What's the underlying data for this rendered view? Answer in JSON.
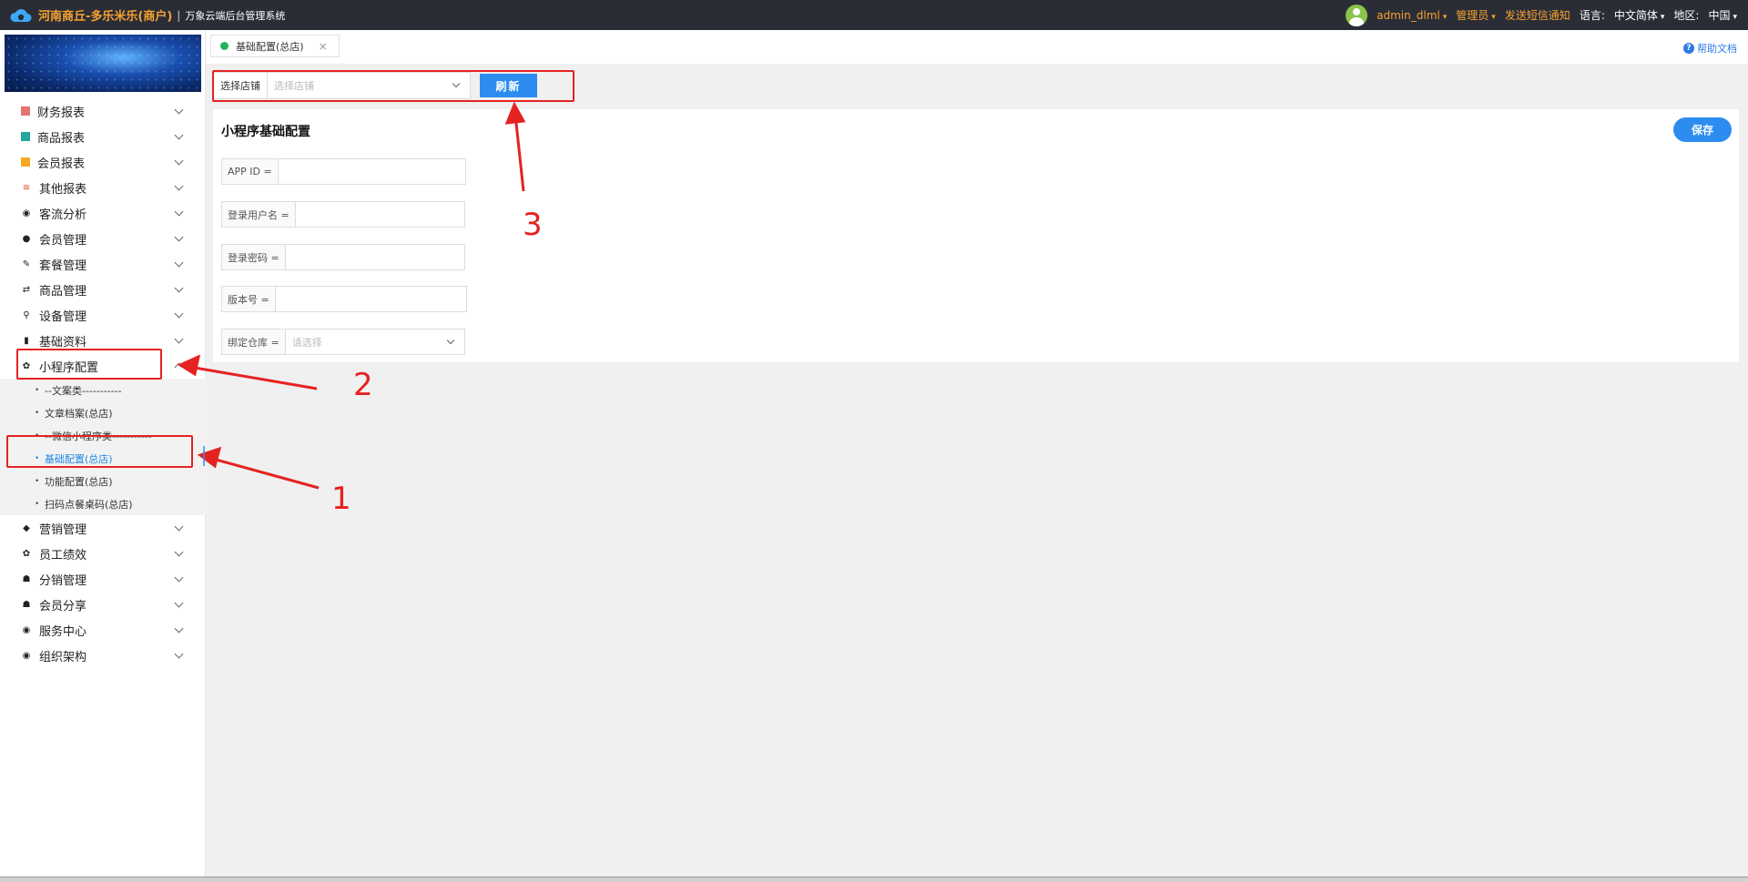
{
  "header": {
    "brand_title": "河南商丘-多乐米乐(商户)",
    "separator": "|",
    "brand_subtitle": "万象云端后台管理系统",
    "username": "admin_dlml",
    "role": "管理员",
    "sms_notice": "发送短信通知",
    "language_label": "语言:",
    "language_value": "中文简体",
    "region_label": "地区:",
    "region_value": "中国"
  },
  "sidebar": {
    "items": [
      {
        "label": "财务报表",
        "icon": "finance-report-icon",
        "color": "#e57373"
      },
      {
        "label": "商品报表",
        "icon": "goods-report-icon",
        "color": "#26a69a"
      },
      {
        "label": "会员报表",
        "icon": "member-report-icon",
        "color": "#f9a825"
      },
      {
        "label": "其他报表",
        "icon": "other-report-icon",
        "color": "#e64a19"
      },
      {
        "label": "客流分析",
        "icon": "traffic-analysis-icon",
        "color": "#555"
      },
      {
        "label": "会员管理",
        "icon": "member-manage-icon",
        "color": "#555"
      },
      {
        "label": "套餐管理",
        "icon": "package-manage-icon",
        "color": "#555"
      },
      {
        "label": "商品管理",
        "icon": "goods-manage-icon",
        "color": "#555"
      },
      {
        "label": "设备管理",
        "icon": "device-manage-icon",
        "color": "#555"
      },
      {
        "label": "基础资料",
        "icon": "basic-data-icon",
        "color": "#555"
      },
      {
        "label": "小程序配置",
        "icon": "gear-icon",
        "color": "#333"
      }
    ],
    "submenu": [
      {
        "label": "--文案类-----------"
      },
      {
        "label": "文章档案(总店)"
      },
      {
        "label": "--微信小程序类-----------"
      },
      {
        "label": "基础配置(总店)"
      },
      {
        "label": "功能配置(总店)"
      },
      {
        "label": "扫码点餐桌码(总店)"
      }
    ],
    "items_after": [
      {
        "label": "营销管理",
        "icon": "tag-icon"
      },
      {
        "label": "员工绩效",
        "icon": "gear-icon"
      },
      {
        "label": "分销管理",
        "icon": "users-icon"
      },
      {
        "label": "会员分享",
        "icon": "users-icon"
      },
      {
        "label": "服务中心",
        "icon": "target-icon"
      },
      {
        "label": "组织架构",
        "icon": "target-icon"
      }
    ]
  },
  "tabs": [
    {
      "label": "基础配置(总店)",
      "close": "×"
    }
  ],
  "help_link": "帮助文档",
  "store_bar": {
    "label": "选择店铺",
    "placeholder": "选择店铺",
    "refresh_label": "刷新"
  },
  "panel": {
    "title": "小程序基础配置",
    "save_label": "保存",
    "fields": [
      {
        "label": "APP ID ="
      },
      {
        "label": "登录用户名 ="
      },
      {
        "label": "登录密码 ="
      },
      {
        "label": "版本号 ="
      },
      {
        "label": "绑定仓库 =",
        "placeholder": "请选择"
      }
    ]
  },
  "annotations": {
    "one": "1",
    "two": "2",
    "three": "3",
    "color": "#e52222"
  }
}
